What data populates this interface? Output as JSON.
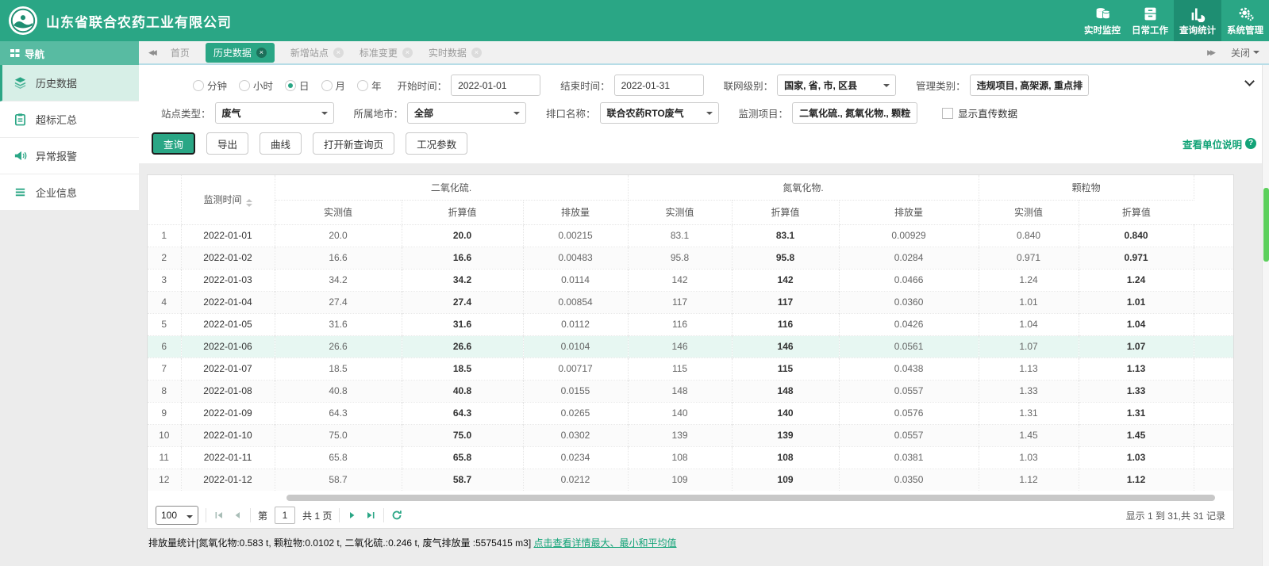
{
  "topbar": {
    "company": "山东省联合农药工业有限公司",
    "menus": [
      {
        "label": "实时监控",
        "icon": "database-icon"
      },
      {
        "label": "日常工作",
        "icon": "drawer-icon"
      },
      {
        "label": "查询统计",
        "icon": "bar-chart-icon"
      },
      {
        "label": "系统管理",
        "icon": "gear-icon"
      }
    ],
    "active_menu": "查询统计"
  },
  "tabbar": {
    "nav_title": "导航",
    "tabs": [
      {
        "label": "首页",
        "closable": false,
        "active": false
      },
      {
        "label": "历史数据",
        "closable": true,
        "active": true
      },
      {
        "label": "新增站点",
        "closable": true,
        "active": false
      },
      {
        "label": "标准变更",
        "closable": true,
        "active": false
      },
      {
        "label": "实时数据",
        "closable": true,
        "active": false
      }
    ],
    "close_label": "关闭"
  },
  "sidebar": {
    "items": [
      {
        "label": "历史数据",
        "icon": "layers-icon",
        "active": true
      },
      {
        "label": "超标汇总",
        "icon": "clipboard-icon",
        "active": false
      },
      {
        "label": "异常报警",
        "icon": "alarm-speaker-icon",
        "active": false
      },
      {
        "label": "企业信息",
        "icon": "list-icon",
        "active": false
      }
    ]
  },
  "filters": {
    "periods": [
      "分钟",
      "小时",
      "日",
      "月",
      "年"
    ],
    "selected_period": "日",
    "start_time": {
      "label": "开始时间：",
      "value": "2022-01-01"
    },
    "end_time": {
      "label": "结束时间：",
      "value": "2022-01-31"
    },
    "network_level": {
      "label": "联网级别：",
      "value": "国家, 省, 市, 区县"
    },
    "manage_type": {
      "label": "管理类别：",
      "value": "违规项目, 高架源, 重点排"
    },
    "site_type": {
      "label": "站点类型：",
      "value": "废气"
    },
    "city": {
      "label": "所属地市：",
      "value": "全部"
    },
    "outlet": {
      "label": "排口名称：",
      "value": "联合农药RTO废气"
    },
    "monitor_items": {
      "label": "监测项目：",
      "value": "二氧化硫., 氮氧化物., 颗粒"
    },
    "direct_data_label": "显示直传数据",
    "direct_data_checked": false,
    "buttons": {
      "query": "查询",
      "export": "导出",
      "curve": "曲线",
      "new_query": "打开新查询页",
      "condition": "工况参数"
    },
    "unit_help": "查看单位说明"
  },
  "table": {
    "time_col": "监测时间",
    "groups": [
      {
        "label": "二氧化硫.",
        "subs": [
          "实测值",
          "折算值",
          "排放量"
        ]
      },
      {
        "label": "氮氧化物.",
        "subs": [
          "实测值",
          "折算值",
          "排放量"
        ]
      },
      {
        "label": "颗粒物",
        "subs": [
          "实测值",
          "折算值"
        ]
      }
    ],
    "highlight_row": 5,
    "bold_cols": [
      3,
      6,
      9
    ],
    "rows": [
      [
        "1",
        "2022-01-01",
        "20.0",
        "20.0",
        "0.00215",
        "83.1",
        "83.1",
        "0.00929",
        "0.840",
        "0.840"
      ],
      [
        "2",
        "2022-01-02",
        "16.6",
        "16.6",
        "0.00483",
        "95.8",
        "95.8",
        "0.0284",
        "0.971",
        "0.971"
      ],
      [
        "3",
        "2022-01-03",
        "34.2",
        "34.2",
        "0.0114",
        "142",
        "142",
        "0.0466",
        "1.24",
        "1.24"
      ],
      [
        "4",
        "2022-01-04",
        "27.4",
        "27.4",
        "0.00854",
        "117",
        "117",
        "0.0360",
        "1.01",
        "1.01"
      ],
      [
        "5",
        "2022-01-05",
        "31.6",
        "31.6",
        "0.0112",
        "116",
        "116",
        "0.0426",
        "1.04",
        "1.04"
      ],
      [
        "6",
        "2022-01-06",
        "26.6",
        "26.6",
        "0.0104",
        "146",
        "146",
        "0.0561",
        "1.07",
        "1.07"
      ],
      [
        "7",
        "2022-01-07",
        "18.5",
        "18.5",
        "0.00717",
        "115",
        "115",
        "0.0438",
        "1.13",
        "1.13"
      ],
      [
        "8",
        "2022-01-08",
        "40.8",
        "40.8",
        "0.0155",
        "148",
        "148",
        "0.0557",
        "1.33",
        "1.33"
      ],
      [
        "9",
        "2022-01-09",
        "64.3",
        "64.3",
        "0.0265",
        "140",
        "140",
        "0.0576",
        "1.31",
        "1.31"
      ],
      [
        "10",
        "2022-01-10",
        "75.0",
        "75.0",
        "0.0302",
        "139",
        "139",
        "0.0557",
        "1.45",
        "1.45"
      ],
      [
        "11",
        "2022-01-11",
        "65.8",
        "65.8",
        "0.0234",
        "108",
        "108",
        "0.0381",
        "1.03",
        "1.03"
      ],
      [
        "12",
        "2022-01-12",
        "58.7",
        "58.7",
        "0.0212",
        "109",
        "109",
        "0.0350",
        "1.12",
        "1.12"
      ]
    ]
  },
  "pagination": {
    "page_size": "100",
    "page_prefix": "第",
    "page_value": "1",
    "page_total": "共 1 页",
    "records_info": "显示 1 到 31,共 31 记录"
  },
  "footer": {
    "stats": "排放量统计[氮氧化物:0.583 t, 颗粒物:0.0102 t, 二氧化硫.:0.246 t, 废气排放量 :5575415 m3] ",
    "detail_link": "点击查看详情最大、最小和平均值"
  },
  "colors": {
    "brand_teal": "#2aa685",
    "brand_teal_dark": "#1e8e72",
    "scroll_thumb_green": "#5cd05c"
  }
}
